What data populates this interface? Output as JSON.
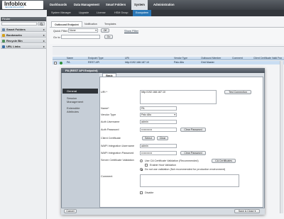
{
  "header": {
    "logo": {
      "name": "Infoblox",
      "tagline": "SECURE DNS & DHCP"
    },
    "tabs": [
      {
        "label": "Dashboards"
      },
      {
        "label": "Data Management"
      },
      {
        "label": "Smart Folders"
      },
      {
        "label": "System"
      },
      {
        "label": "Administration"
      }
    ],
    "active_tab": "System"
  },
  "subnav": {
    "tabs": [
      {
        "label": "System Manager"
      },
      {
        "label": "Upgrade"
      },
      {
        "label": "License"
      },
      {
        "label": "HSM Group"
      },
      {
        "label": "Ecosystem"
      }
    ],
    "active_tab": "Ecosystem"
  },
  "sidebar": {
    "title": "Finder",
    "items": [
      {
        "label": "Smart Folders",
        "icon": "folder-icon"
      },
      {
        "label": "Bookmarks",
        "icon": "bookmark-icon"
      },
      {
        "label": "Recycle Bin",
        "icon": "trash-icon"
      },
      {
        "label": "URL Links",
        "icon": "link-icon"
      }
    ]
  },
  "content": {
    "tabs": [
      {
        "label": "Outbound Endpoint"
      },
      {
        "label": "Notification"
      },
      {
        "label": "Templates"
      }
    ],
    "toolbar": {
      "quick_filter_label": "Quick Filter",
      "quick_filter_value": "None",
      "off_button": "Off",
      "show_filter": "Show Filter",
      "goto_label": "Go to",
      "go_button": "Go"
    },
    "grid": {
      "columns": [
        "Name",
        "Endpoint Type",
        "URI",
        "Vendor Type",
        "Outbound Member",
        "Comment",
        "Client Certificate Valid From"
      ],
      "rows": [
        [
          "PA",
          "REST API",
          "http://192.168.187.10",
          "Palo Alto",
          "Grid Master",
          "",
          ""
        ]
      ]
    }
  },
  "modal": {
    "title": "PA (REST API Endpoint)",
    "sections": [
      {
        "label": "General"
      },
      {
        "label": "Session Management"
      },
      {
        "label": "Extensible Attributes"
      }
    ],
    "active_section": "General",
    "tab": "Basic",
    "fields": {
      "uri_label": "URI *",
      "uri_value": "http://192.168.187.10",
      "test_connection": "Test Connection",
      "name_label": "Name*",
      "name_value": "PA",
      "vendor_label": "Vendor Type",
      "vendor_value": "Palo Alto",
      "auth_user_label": "Auth Username",
      "auth_user_value": "admin",
      "auth_pw_label": "Auth Password",
      "auth_pw_value": "••••••••••••",
      "clear_password": "Clear Password",
      "client_cert_label": "Client Certificate",
      "select_button": "Select",
      "clear_button": "Clear",
      "wapi_user_label": "WAPI Integration Username",
      "wapi_user_value": "admin",
      "wapi_pw_label": "WAPI Integration Password",
      "wapi_pw_value": "••••••••••••",
      "wapi_clear_password": "Clear Password",
      "server_cert_label": "Server Certificate Validation",
      "radio_ca": "Use CA Certificate Validation (Recommended)",
      "ca_certificates": "CA Certificates",
      "enable_host_validation": "Enable Host Validation",
      "radio_none": "Do not use validation (Not recommended for production environment)",
      "comment_label": "Comment",
      "disable_label": "Disable"
    },
    "footer": {
      "cancel": "Cancel",
      "save": "Save & Close"
    }
  }
}
